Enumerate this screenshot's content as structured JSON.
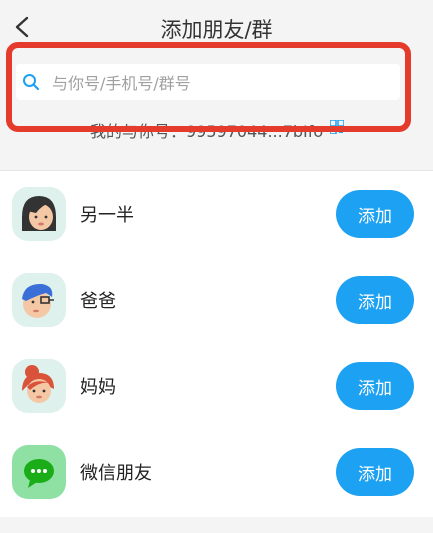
{
  "header": {
    "title": "添加朋友/群"
  },
  "search": {
    "placeholder": "与你号/手机号/群号",
    "value": ""
  },
  "my_id": {
    "text": "我的与你号：99597044...7bIfo"
  },
  "list": {
    "items": [
      {
        "label": "另一半",
        "button": "添加",
        "icon": "woman-avatar-icon"
      },
      {
        "label": "爸爸",
        "button": "添加",
        "icon": "man-glasses-avatar-icon"
      },
      {
        "label": "妈妈",
        "button": "添加",
        "icon": "mom-avatar-icon"
      },
      {
        "label": "微信朋友",
        "button": "添加",
        "icon": "wechat-icon"
      }
    ]
  },
  "colors": {
    "accent": "#1da1f2",
    "highlight": "#e53b2c",
    "background": "#f4f4f4"
  }
}
